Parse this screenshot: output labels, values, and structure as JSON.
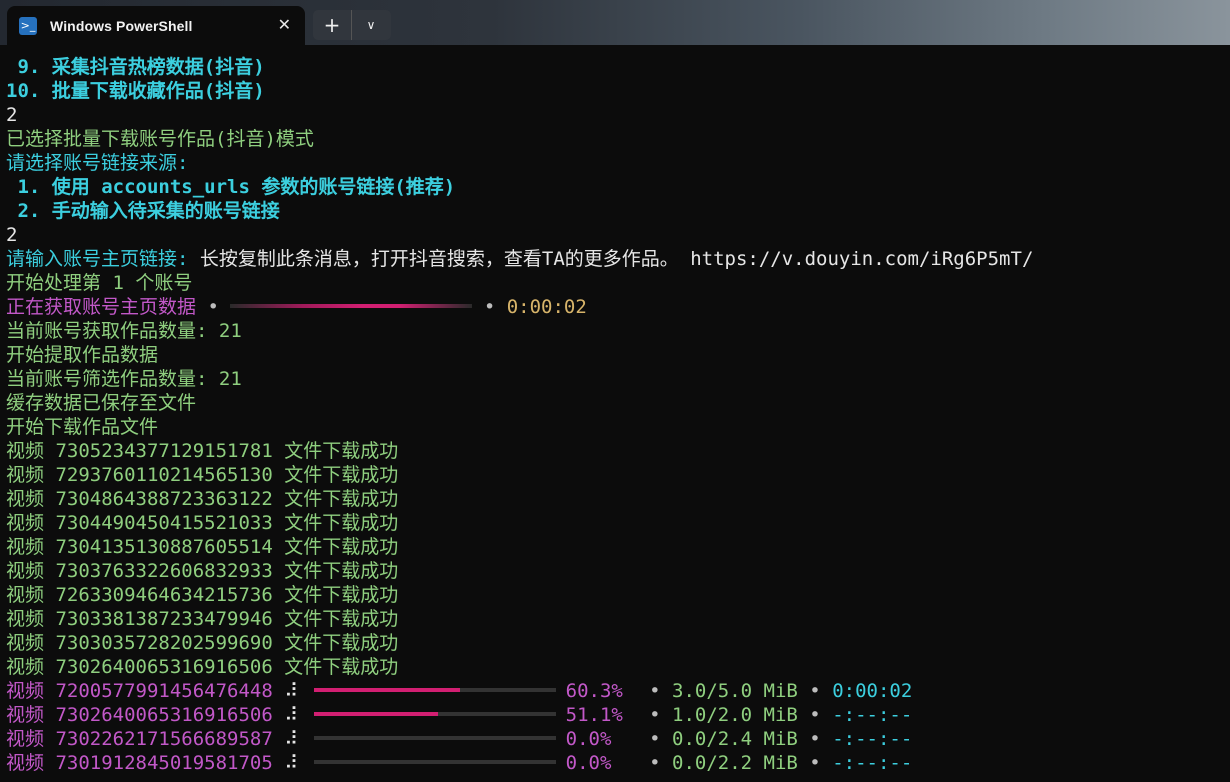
{
  "window": {
    "tab_title": "Windows PowerShell",
    "tab_icon": "powershell-icon",
    "close_glyph": "✕",
    "new_tab_glyph": "+",
    "dropdown_glyph": "∨"
  },
  "terminal": {
    "menu9": " 9. 采集抖音热榜数据(抖音)",
    "menu10": "10. 批量下载收藏作品(抖音)",
    "input1": "2",
    "mode_selected": "已选择批量下载账号作品(抖音)模式",
    "choose_source": "请选择账号链接来源:",
    "source1": " 1. 使用 accounts_urls 参数的账号链接(推荐)",
    "source2": " 2. 手动输入待采集的账号链接",
    "input2": "2",
    "prompt_url": "请输入账号主页链接: ",
    "url_value": "长按复制此条消息，打开抖音搜索，查看TA的更多作品。 https://v.douyin.com/iRg6P5mT/",
    "start_account": "开始处理第 1 个账号",
    "fetching_label": "正在获取账号主页数据",
    "fetching_elapsed": "0:00:02",
    "bullet": "•",
    "count_label": "当前账号获取作品数量: 21",
    "extract_start": "开始提取作品数据",
    "filter_count": "当前账号筛选作品数量: 21",
    "cache_saved": "缓存数据已保存至文件",
    "download_start": "开始下载作品文件"
  },
  "success_label": "视频",
  "success_suffix": "文件下载成功",
  "success_ids": [
    "7305234377129151781",
    "7293760110214565130",
    "7304864388723363122",
    "7304490450415521033",
    "7304135130887605514",
    "7303763322606832933",
    "7263309464634215736",
    "7303381387233479946",
    "7303035728202599690",
    "7302640065316916506"
  ],
  "progress_rows": [
    {
      "label": "视频",
      "id": "7200577991456476448",
      "spinner": "⠼",
      "progress": 0.603,
      "percent": "60.3%",
      "size": "3.0/5.0 MiB",
      "eta": "0:00:02"
    },
    {
      "label": "视频",
      "id": "7302640065316916506",
      "spinner": "⠼",
      "progress": 0.511,
      "percent": "51.1%",
      "size": "1.0/2.0 MiB",
      "eta": "-:--:--"
    },
    {
      "label": "视频",
      "id": "7302262171566689587",
      "spinner": "⠼",
      "progress": 0.0,
      "percent": "0.0%",
      "size": "0.0/2.4 MiB",
      "eta": "-:--:--"
    },
    {
      "label": "视频",
      "id": "7301912845019581705",
      "spinner": "⠼",
      "progress": 0.0,
      "percent": "0.0%",
      "size": "0.0/2.2 MiB",
      "eta": "-:--:--"
    }
  ],
  "colors": {
    "background": "#0c0c0c",
    "cyan": "#3ccfdf",
    "green": "#8fcf7f",
    "magenta": "#c258c8",
    "gold": "#d7b46a",
    "bar_fill": "#d21f72"
  }
}
